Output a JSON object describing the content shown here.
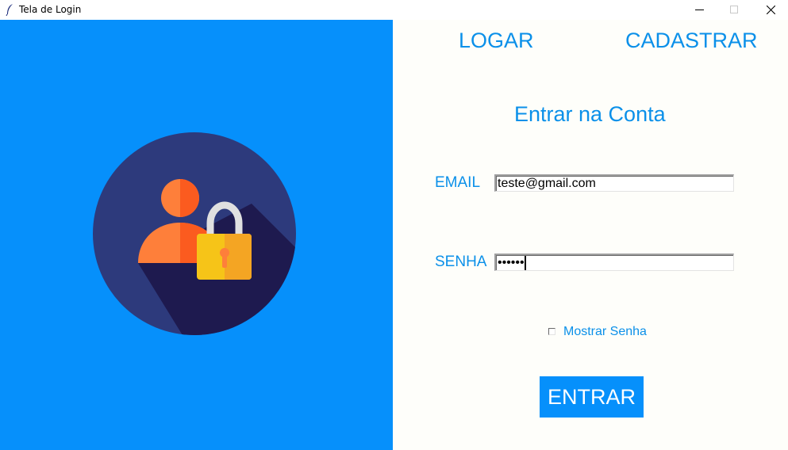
{
  "window": {
    "title": "Tela de Login",
    "controls": [
      "minimize-icon",
      "maximize-icon",
      "close-icon"
    ]
  },
  "colors": {
    "left_panel": "#0690fb",
    "accent_text": "#0b90e9",
    "button_bg": "#0690fb",
    "circle": "#2d3a7c",
    "shadow": "#1e1a4f",
    "person": "#fe7f3a",
    "padlock": "#f6c418"
  },
  "illustration": {
    "icon": "user-lock-icon"
  },
  "tabs": {
    "logar": "LOGAR",
    "cadastrar": "CADASTRAR"
  },
  "form": {
    "heading": "Entrar na Conta",
    "email_label": "EMAIL",
    "email_value": "teste@gmail.com",
    "senha_label": "SENHA",
    "senha_value": "••••••",
    "show_password_label": "Mostrar Senha",
    "show_password_checked": false,
    "submit_label": "ENTRAR"
  }
}
